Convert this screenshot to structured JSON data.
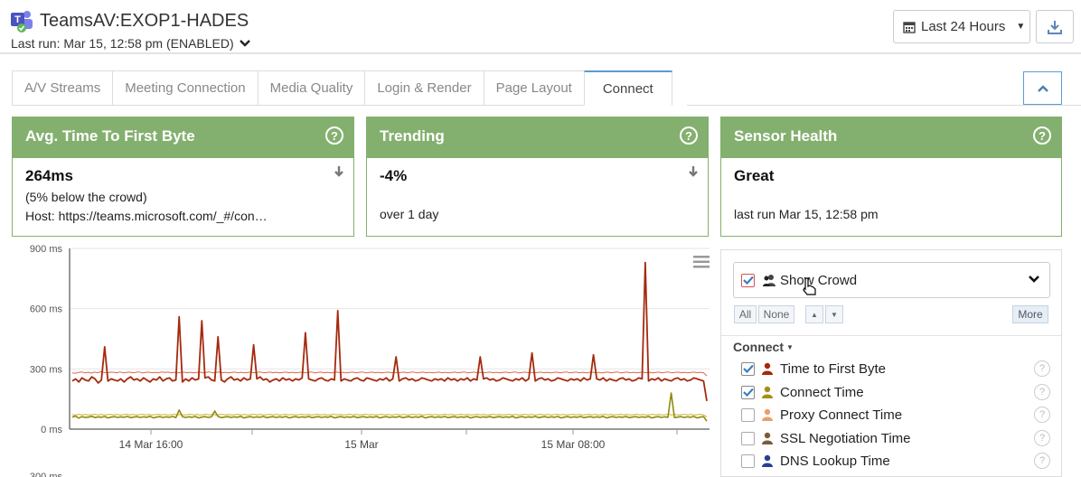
{
  "header": {
    "app_icon": "teams-icon",
    "title": "TeamsAV:EXOP1-HADES",
    "last_run": "Last run: Mar 15, 12:58 pm (ENABLED)",
    "range_label": "Last 24 Hours",
    "download_icon": "download-icon"
  },
  "tabs": [
    {
      "label": "A/V Streams",
      "active": false
    },
    {
      "label": "Meeting Connection",
      "active": false
    },
    {
      "label": "Media Quality",
      "active": false
    },
    {
      "label": "Login & Render",
      "active": false
    },
    {
      "label": "Page Layout",
      "active": false
    },
    {
      "label": "Connect",
      "active": true
    }
  ],
  "cards": {
    "ttfb": {
      "title": "Avg. Time To First Byte",
      "value": "264ms",
      "line1": "(5% below the crowd)",
      "line2": "Host: https://teams.microsoft.com/_#/con…"
    },
    "trending": {
      "title": "Trending",
      "value": "-4%",
      "line1": "over 1 day"
    },
    "health": {
      "title": "Sensor Health",
      "value": "Great",
      "line1": "last run Mar 15, 12:58 pm"
    }
  },
  "colors": {
    "card_green": "#84b06f",
    "ttfb_series": "#a52a0e",
    "ttfb_crowd": "#d9694a",
    "connect_series": "#8f8a10",
    "connect_crowd": "#c9b32a",
    "proxy": "#e8a06a",
    "ssl": "#7a5a3a",
    "dns": "#2a3f8f"
  },
  "chart_data": {
    "type": "line",
    "title": "",
    "xlabel": "",
    "ylabel": "",
    "ylim": [
      0,
      900
    ],
    "y_ticks": [
      "900 ms",
      "600 ms",
      "300 ms",
      "0 ms"
    ],
    "y_partial_tick": "300 ms",
    "x_ticks": [
      "14 Mar 16:00",
      "15 Mar",
      "15 Mar 08:00"
    ],
    "grid": true,
    "series": [
      {
        "name": "Time to First Byte",
        "values": [
          240,
          250,
          235,
          255,
          245,
          240,
          260,
          250,
          230,
          245,
          255,
          240,
          250,
          245,
          240,
          250,
          235,
          250,
          260,
          245,
          250,
          240,
          255,
          245,
          235,
          250,
          245,
          260,
          240,
          250,
          255,
          240,
          245,
          250,
          235,
          250,
          240,
          255,
          245,
          250,
          240,
          255,
          260,
          245,
          240,
          250,
          245,
          235,
          250,
          260,
          245,
          250,
          240,
          255,
          245,
          250,
          240,
          250,
          260,
          245,
          250,
          235,
          245,
          250,
          240,
          255,
          245,
          250,
          240,
          250,
          245,
          255,
          240,
          250,
          245,
          240,
          250,
          255,
          245,
          240,
          250,
          245,
          255,
          240,
          250,
          245,
          240,
          250,
          255,
          245,
          240,
          255,
          250,
          245,
          240,
          250,
          245,
          255,
          240,
          250,
          245,
          240,
          250,
          255,
          245,
          250,
          240,
          245,
          255,
          250,
          245,
          240,
          250,
          245,
          250,
          240,
          255,
          245,
          250,
          240,
          250,
          245,
          255,
          240,
          250,
          245,
          240,
          250,
          255,
          245,
          250,
          240,
          245,
          255,
          250,
          245,
          240,
          250,
          245,
          255,
          240,
          250,
          245,
          240,
          250,
          255,
          245,
          250,
          240,
          245,
          255,
          250,
          245,
          240,
          250,
          245,
          250,
          240,
          255,
          245,
          250,
          240,
          250,
          245,
          255,
          240,
          250,
          245,
          240,
          250,
          255,
          245,
          250,
          240,
          245,
          255,
          250,
          245,
          240,
          250,
          245,
          255,
          240,
          250,
          245,
          240,
          250,
          255,
          245,
          250,
          240,
          245,
          255,
          250,
          245,
          240,
          140
        ],
        "spikes": [
          [
            10,
            410
          ],
          [
            33,
            560
          ],
          [
            40,
            540
          ],
          [
            45,
            460
          ],
          [
            56,
            420
          ],
          [
            72,
            480
          ],
          [
            82,
            590
          ],
          [
            100,
            360
          ],
          [
            126,
            360
          ],
          [
            142,
            380
          ],
          [
            161,
            370
          ],
          [
            177,
            830
          ]
        ]
      },
      {
        "name": "Connect Time",
        "values": [
          60,
          65,
          55,
          62,
          58,
          60,
          64,
          57,
          61,
          59,
          63,
          56,
          60,
          62,
          58,
          61,
          59,
          63,
          57,
          60,
          62,
          58,
          61,
          59,
          64,
          56,
          60,
          62,
          58,
          61,
          59,
          63,
          57,
          60,
          62,
          58,
          61,
          59,
          63,
          56,
          60,
          62,
          58,
          61,
          59,
          63,
          57,
          60,
          62,
          58,
          61,
          59,
          64,
          56,
          60,
          62,
          58,
          61,
          59,
          63,
          57,
          60,
          62,
          58,
          61,
          59,
          63,
          56,
          60,
          62,
          58,
          61,
          59,
          63,
          57,
          60,
          62,
          58,
          61,
          59,
          64,
          56,
          60,
          62,
          58,
          61,
          59,
          63,
          57,
          60,
          62,
          58,
          61,
          59,
          63,
          56,
          60,
          62,
          58,
          61,
          59,
          63,
          57,
          60,
          62,
          58,
          61,
          59,
          64,
          56,
          60,
          62,
          58,
          61,
          59,
          63,
          57,
          60,
          62,
          58,
          61,
          59,
          63,
          56,
          60,
          62,
          58,
          61,
          59,
          63,
          57,
          60,
          62,
          58,
          61,
          59,
          64,
          56,
          60,
          62,
          58,
          61,
          59,
          63,
          57,
          60,
          62,
          58,
          61,
          59,
          63,
          56,
          60,
          62,
          58,
          61,
          59,
          63,
          57,
          60,
          62,
          58,
          61,
          59,
          64,
          56,
          60,
          62,
          58,
          61,
          59,
          63,
          57,
          60,
          62,
          58,
          61,
          59,
          63,
          56,
          60,
          62,
          58,
          61,
          59,
          180,
          57,
          60,
          62,
          58,
          61,
          59,
          63,
          56,
          60,
          62,
          40
        ],
        "spikes": [
          [
            33,
            95
          ],
          [
            44,
            90
          ]
        ]
      },
      {
        "values": [
          280,
          278,
          282,
          285,
          280,
          283,
          279,
          284,
          281,
          286,
          282,
          280,
          284,
          283,
          281,
          285,
          280,
          282,
          284,
          281,
          283,
          285,
          280,
          282,
          284,
          281,
          283,
          280,
          285,
          282,
          284,
          281,
          283,
          280,
          282,
          284,
          281,
          283,
          280,
          282,
          284,
          281,
          283,
          285,
          280,
          282,
          284,
          281,
          283,
          280,
          282,
          284,
          281,
          283,
          280,
          282,
          284,
          281,
          283,
          285,
          280,
          282,
          284,
          281,
          283,
          280,
          282,
          284,
          281,
          283,
          280,
          282,
          284,
          281,
          283,
          285,
          280,
          282,
          284,
          281,
          283,
          280,
          282,
          284,
          281,
          283,
          280,
          282,
          284,
          281,
          283,
          285,
          280,
          282,
          284,
          281,
          283,
          280,
          282,
          284,
          281,
          283,
          280,
          282,
          284,
          281,
          283,
          285,
          280,
          282,
          284,
          281,
          283,
          280,
          282,
          284,
          281,
          283,
          280,
          282,
          284,
          281,
          283,
          285,
          280,
          282,
          284,
          281,
          283,
          280,
          282,
          284,
          281,
          283,
          280,
          282,
          284,
          281,
          283,
          285,
          280,
          282,
          284,
          281,
          283,
          280,
          282,
          284,
          281,
          283,
          280,
          282,
          284,
          281,
          283,
          285,
          280,
          282,
          284,
          281,
          283,
          280,
          282,
          284,
          281,
          283,
          280,
          282,
          284,
          281,
          283,
          285,
          280,
          282,
          284,
          281,
          283,
          280,
          282,
          284,
          281,
          283,
          280,
          282,
          284,
          281,
          283,
          285,
          280,
          282,
          284,
          281,
          283,
          280,
          282,
          284,
          281,
          283,
          280,
          265
        ]
      },
      {
        "values": [
          72,
          70,
          74,
          71,
          73,
          70,
          72,
          74,
          71,
          73,
          70,
          72,
          74,
          71,
          73,
          70,
          72,
          74,
          71,
          73,
          70,
          72,
          74,
          71,
          73,
          70,
          72,
          74,
          71,
          73,
          70,
          72,
          74,
          71,
          73,
          70,
          72,
          74,
          71,
          73,
          70,
          72,
          74,
          71,
          73,
          70,
          72,
          74,
          71,
          73,
          70,
          72,
          74,
          71,
          73,
          70,
          72,
          74,
          71,
          73,
          70,
          72,
          74,
          71,
          73,
          70,
          72,
          74,
          71,
          73,
          70,
          72,
          74,
          71,
          73,
          70,
          72,
          74,
          71,
          73,
          70,
          72,
          74,
          71,
          73,
          70,
          72,
          74,
          71,
          73,
          70,
          72,
          74,
          71,
          73,
          70,
          72,
          74,
          71,
          73,
          70,
          72,
          74,
          71,
          73,
          70,
          72,
          74,
          71,
          73,
          70,
          72,
          74,
          71,
          73,
          70,
          72,
          74,
          71,
          73,
          70,
          72,
          74,
          71,
          73,
          70,
          72,
          74,
          71,
          73,
          70,
          72,
          74,
          71,
          73,
          70,
          72,
          74,
          71,
          73,
          70,
          72,
          74,
          71,
          73,
          70,
          72,
          74,
          71,
          73,
          70,
          72,
          74,
          71,
          73,
          70,
          72,
          74,
          71,
          73,
          70,
          72,
          74,
          71,
          73,
          70,
          72,
          74,
          71,
          73,
          70,
          72,
          74,
          71,
          73,
          70,
          72,
          74,
          71,
          73,
          70,
          72,
          74,
          71,
          73,
          70,
          72,
          74,
          71,
          73,
          70,
          72,
          74,
          71,
          73,
          70,
          72,
          74,
          71,
          60
        ]
      }
    ]
  },
  "side_panel": {
    "crowd_label": "Show Crowd",
    "crowd_checked": true,
    "all_label": "All",
    "none_label": "None",
    "more_label": "More",
    "group_label": "Connect",
    "metrics": [
      {
        "label": "Time to First Byte",
        "checked": true,
        "icon": "user-icon"
      },
      {
        "label": "Connect Time",
        "checked": true,
        "icon": "user-icon"
      },
      {
        "label": "Proxy Connect Time",
        "checked": false,
        "icon": "user-icon"
      },
      {
        "label": "SSL Negotiation Time",
        "checked": false,
        "icon": "user-icon"
      },
      {
        "label": "DNS Lookup Time",
        "checked": false,
        "icon": "user-icon"
      }
    ]
  }
}
